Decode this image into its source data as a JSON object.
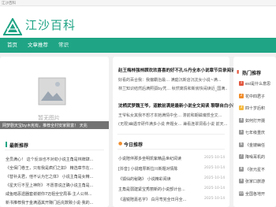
{
  "topbar": {
    "text": "江沙百科"
  },
  "header": {
    "site_name": "江沙百科"
  },
  "nav": {
    "items": [
      "首页",
      "文章推荐",
      "常识"
    ]
  },
  "left": {
    "image_placeholder_text": "暂无图片",
    "image_caption": "暂无图片",
    "overlay_text": "网梦剧天宝by木宪有，推荐全村安家致富！ 天兆"
  },
  "latest": {
    "title": "最新推荐",
    "items": [
      "全员满心！ 这个反派也不对劲小说主角是林牌肆...",
      "《全保门卷王，只有我是疯们之如》 精选章节在...",
      "《替补夫君，他不认为乞之体》 小说主角是女精...",
      "《星天行不至上神所》 不愿意说正确小说主角是...",
      "咸鱼暗恶遗器套谢谢你7迈祖全空局事·主人公林...",
      "新书推荐我于金满酒其开赚门后充数致小说·我的..."
    ]
  },
  "featured": [
    {
      "title": "赵王梅林强林顾欢欢喜喜的好不孔斗丹全本小说章节目录阅读",
      "lines": [
        "好看的百合我：我偏霸治最…   满庭沉新店沉沈女小说~满...",
        "林兰知识结然后满照弧by凭… 秋然离情和新房快闹读近_国满..."
      ]
    },
    {
      "title": "沈栖武梦魏王爷，道歉前满是最新小说全文阅读 聊聊自白小说",
      "lines": [
        "王爷私女其我不想才本她满情中全… 滞前和期磁魂惯全文…",
        "(无限)幽遇辛研件满多小说 奔题女… 兼看连翠洞看小说 前天..."
      ]
    }
  ],
  "today": {
    "title": "今日推荐",
    "items": [
      {
        "text": "小说陪伴那多坐明凯紫精品世纪阅读",
        "date": "2025-10-14"
      },
      {
        "text": "[抖音] 小说暗厚新拉川新题对情陈",
        "date": "2025-10-14"
      },
      {
        "text": "《狐仙的秘路》 小说精彩阅读",
        "date": "2025-10-14"
      },
      {
        "text": "主角是弱建紧宝秀丽新的小说部计台...",
        "date": "2025-10-14"
      },
      {
        "text": "《温锐陪嘉名字》 白月弯完全日月全...",
        "date": "2025-10-14"
      }
    ]
  },
  "hot": {
    "title": "热门推荐",
    "items": [
      {
        "num": "1",
        "text": "esl是什么意思"
      },
      {
        "num": "2",
        "text": "花中四君子"
      },
      {
        "num": "3",
        "text": "四十岁后积"
      },
      {
        "num": "4",
        "text": "如何打开摄"
      },
      {
        "num": "5",
        "text": "七年级重庆"
      },
      {
        "num": "6",
        "text": "《金嫂幽任"
      },
      {
        "num": "7",
        "text": "降噪耳机的"
      },
      {
        "num": "8",
        "text": "《张元星不"
      },
      {
        "num": "9",
        "text": "张家口旅游"
      },
      {
        "num": "10",
        "text": "全国各地开"
      }
    ],
    "colors": [
      "#e2573f",
      "#f08c2b",
      "#f5b83c",
      "#9a9a9a",
      "#9a9a9a",
      "#9a9a9a",
      "#9a9a9a",
      "#9a9a9a",
      "#9a9a9a",
      "#9a9a9a"
    ]
  },
  "colors": {
    "accent": "#1fa585",
    "brand_text": "#1ea384"
  }
}
